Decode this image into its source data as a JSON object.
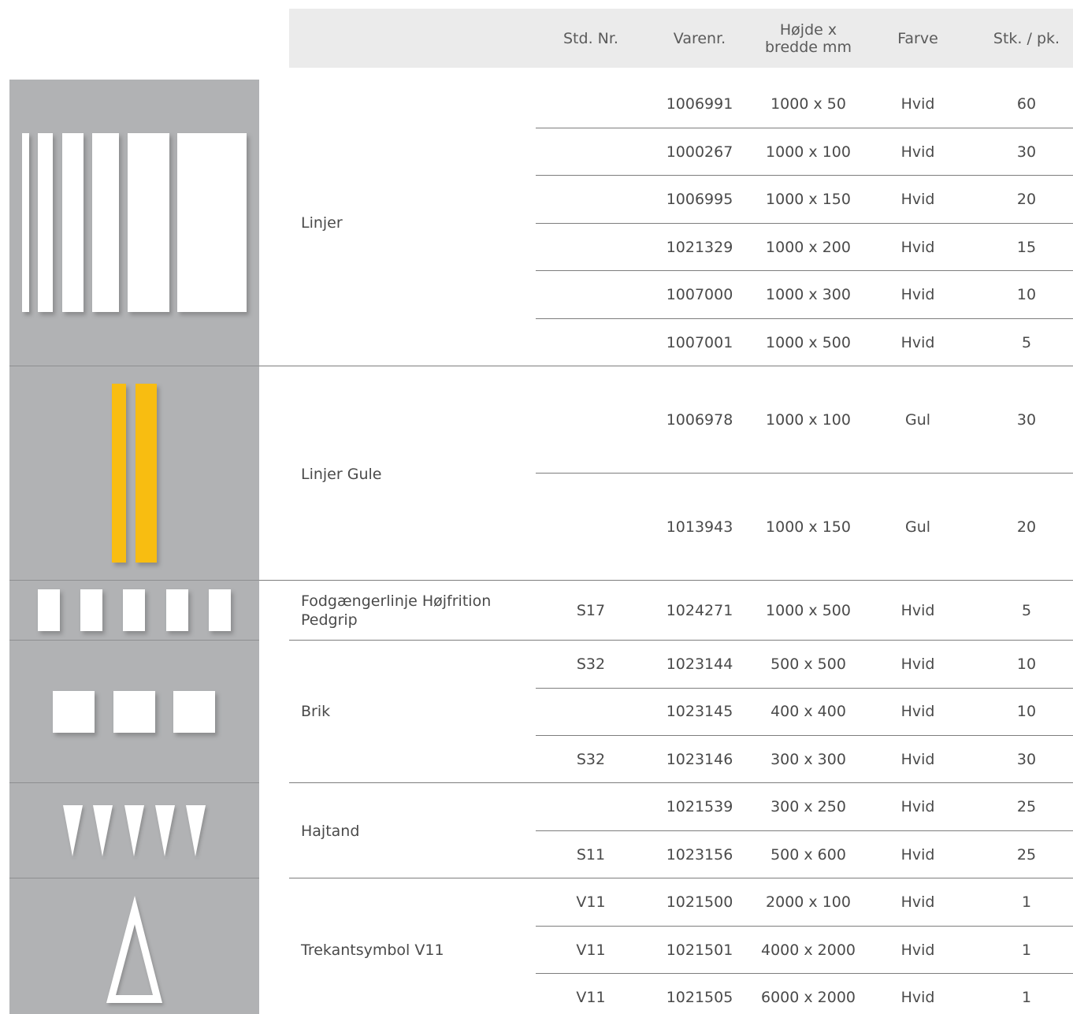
{
  "table": {
    "headers": {
      "std_nr": "Std. Nr.",
      "varenr": "Varenr.",
      "size_line1": "Højde x",
      "size_line2": "bredde mm",
      "farve": "Farve",
      "stk": "Stk. / pk."
    },
    "groups": [
      {
        "name": "Linjer",
        "rows": [
          {
            "std": "",
            "varenr": "1006991",
            "size": "1000 x 50",
            "farve": "Hvid",
            "stk": "60"
          },
          {
            "std": "",
            "varenr": "1000267",
            "size": "1000 x 100",
            "farve": "Hvid",
            "stk": "30"
          },
          {
            "std": "",
            "varenr": "1006995",
            "size": "1000 x 150",
            "farve": "Hvid",
            "stk": "20"
          },
          {
            "std": "",
            "varenr": "1021329",
            "size": "1000 x 200",
            "farve": "Hvid",
            "stk": "15"
          },
          {
            "std": "",
            "varenr": "1007000",
            "size": "1000 x 300",
            "farve": "Hvid",
            "stk": "10"
          },
          {
            "std": "",
            "varenr": "1007001",
            "size": "1000 x 500",
            "farve": "Hvid",
            "stk": "5"
          }
        ]
      },
      {
        "name": "Linjer Gule",
        "rows": [
          {
            "std": "",
            "varenr": "1006978",
            "size": "1000 x 100",
            "farve": "Gul",
            "stk": "30"
          },
          {
            "std": "",
            "varenr": "1013943",
            "size": "1000 x 150",
            "farve": "Gul",
            "stk": "20"
          }
        ]
      },
      {
        "name_line1": "Fodgængerlinje Højfrition",
        "name_line2": "Pedgrip",
        "rows": [
          {
            "std": "S17",
            "varenr": "1024271",
            "size": "1000 x 500",
            "farve": "Hvid",
            "stk": "5"
          }
        ]
      },
      {
        "name": "Brik",
        "rows": [
          {
            "std": "S32",
            "varenr": "1023144",
            "size": "500 x 500",
            "farve": "Hvid",
            "stk": "10"
          },
          {
            "std": "",
            "varenr": "1023145",
            "size": "400 x 400",
            "farve": "Hvid",
            "stk": "10"
          },
          {
            "std": "S32",
            "varenr": "1023146",
            "size": "300 x 300",
            "farve": "Hvid",
            "stk": "30"
          }
        ]
      },
      {
        "name": "Hajtand",
        "rows": [
          {
            "std": "",
            "varenr": "1021539",
            "size": "300 x 250",
            "farve": "Hvid",
            "stk": "25"
          },
          {
            "std": "S11",
            "varenr": "1023156",
            "size": "500 x 600",
            "farve": "Hvid",
            "stk": "25"
          }
        ]
      },
      {
        "name": "Trekantsymbol V11",
        "rows": [
          {
            "std": "V11",
            "varenr": "1021500",
            "size": "2000 x 100",
            "farve": "Hvid",
            "stk": "1"
          },
          {
            "std": "V11",
            "varenr": "1021501",
            "size": "4000 x 2000",
            "farve": "Hvid",
            "stk": "1"
          },
          {
            "std": "V11",
            "varenr": "1021505",
            "size": "6000 x 2000",
            "farve": "Hvid",
            "stk": "1"
          }
        ]
      }
    ]
  },
  "colors": {
    "header_bg": "#ebebeb",
    "image_panel_bg": "#b1b2b4",
    "marking_white": "#ffffff",
    "marking_yellow": "#f8bd11",
    "text": "#4a4a4a"
  },
  "icons": [
    "line-markings-icon",
    "yellow-lines-icon",
    "crosswalk-blocks-icon",
    "square-blocks-icon",
    "shark-teeth-icon",
    "triangle-symbol-icon"
  ]
}
